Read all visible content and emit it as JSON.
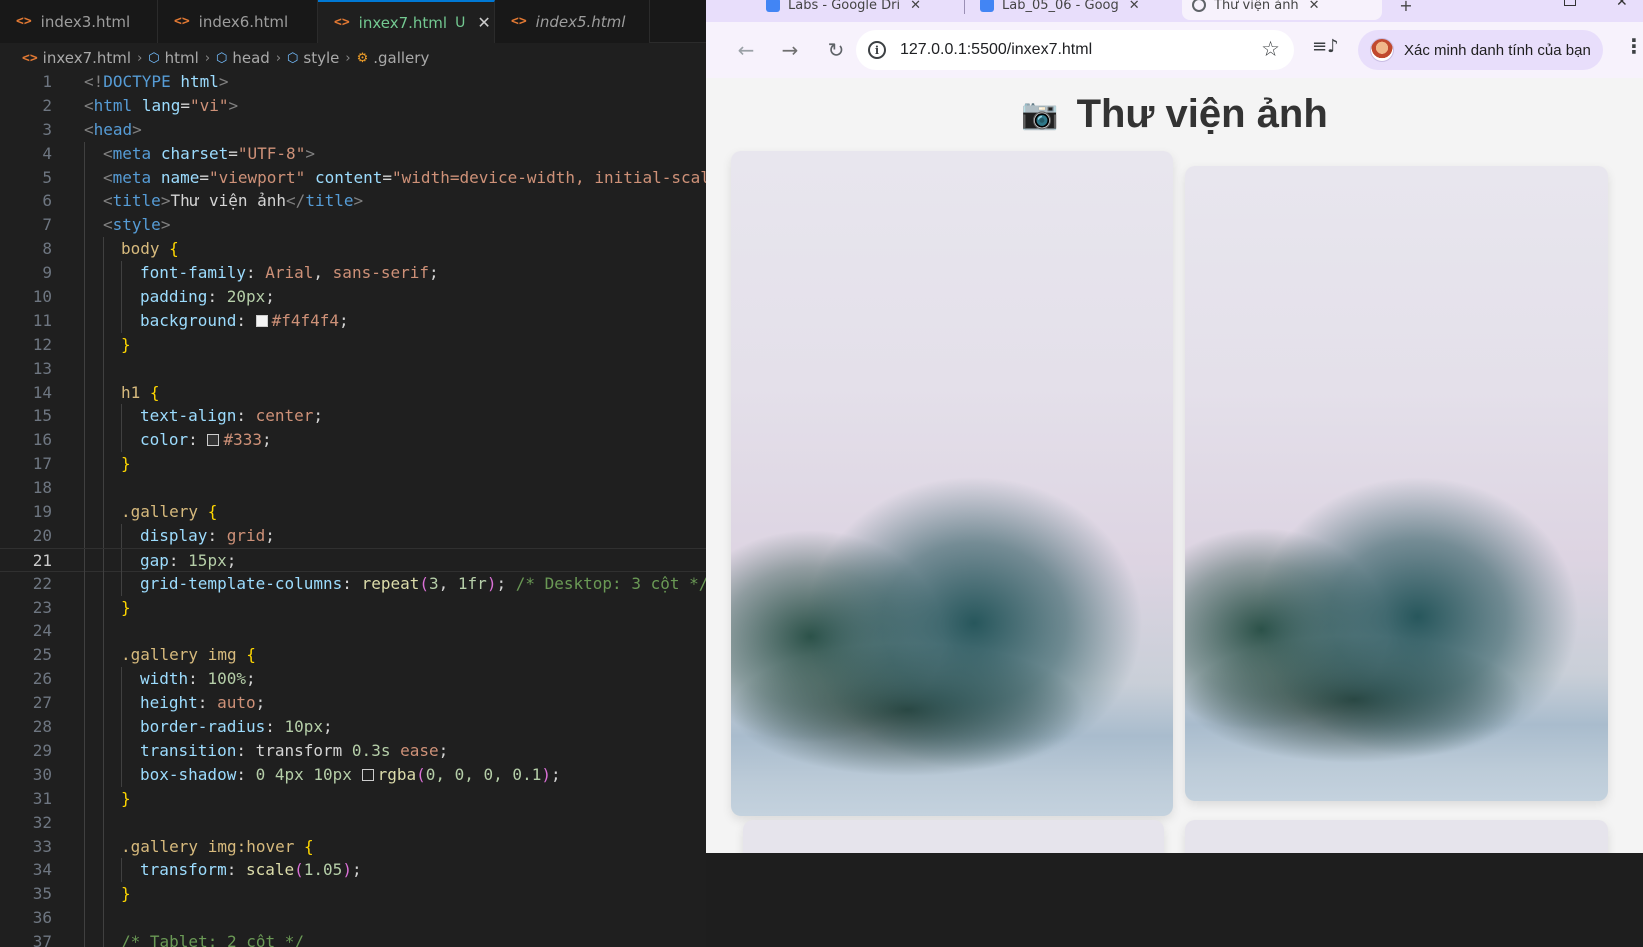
{
  "editor": {
    "tabs": [
      {
        "label": "index3.html",
        "active": false
      },
      {
        "label": "index6.html",
        "active": false
      },
      {
        "label": "inxex7.html",
        "active": true,
        "modified": "U"
      },
      {
        "label": "index5.html",
        "active": false
      }
    ],
    "breadcrumb": [
      "inxex7.html",
      "html",
      "head",
      "style",
      ".gallery"
    ],
    "current_line": 21,
    "line_numbers": [
      "1",
      "2",
      "3",
      "4",
      "5",
      "6",
      "7",
      "8",
      "9",
      "10",
      "11",
      "12",
      "13",
      "14",
      "15",
      "16",
      "17",
      "18",
      "19",
      "20",
      "21",
      "22",
      "23",
      "24",
      "25",
      "26",
      "27",
      "28",
      "29",
      "30",
      "31",
      "32",
      "33",
      "34",
      "35",
      "36",
      "37"
    ],
    "code": {
      "l1": {
        "a": "<!",
        "b": "DOCTYPE",
        "c": "html",
        "d": ">"
      },
      "l2": {
        "a": "<",
        "b": "html",
        "c": "lang",
        "d": "=",
        "e": "\"vi\"",
        "f": ">"
      },
      "l3": {
        "a": "<",
        "b": "head",
        "c": ">"
      },
      "l4": {
        "a": "<",
        "b": "meta",
        "c": "charset",
        "d": "=",
        "e": "\"UTF-8\"",
        "f": ">"
      },
      "l5": {
        "a": "<",
        "b": "meta",
        "c": "name",
        "d": "=",
        "e": "\"viewport\"",
        "f": "content",
        "g": "=",
        "h": "\"width=device-width, initial-scal"
      },
      "l6": {
        "a": "<",
        "b": "title",
        "c": ">",
        "d": "Thư viện ảnh",
        "e": "</",
        "f": "title",
        "g": ">"
      },
      "l7": {
        "a": "<",
        "b": "style",
        "c": ">"
      },
      "l8": {
        "a": "body",
        "b": "{"
      },
      "l9": {
        "a": "font-family",
        "b": ": ",
        "c": "Arial",
        "d": ", ",
        "e": "sans-serif",
        "f": ";"
      },
      "l10": {
        "a": "padding",
        "b": ": ",
        "c": "20px",
        "d": ";"
      },
      "l11": {
        "a": "background",
        "b": ": ",
        "c": "#f4f4f4",
        "d": ";"
      },
      "l12": {
        "a": "}"
      },
      "l14": {
        "a": "h1",
        "b": "{"
      },
      "l15": {
        "a": "text-align",
        "b": ": ",
        "c": "center",
        "d": ";"
      },
      "l16": {
        "a": "color",
        "b": ": ",
        "c": "#333",
        "d": ";"
      },
      "l17": {
        "a": "}"
      },
      "l19": {
        "a": ".gallery",
        "b": "{"
      },
      "l20": {
        "a": "display",
        "b": ": ",
        "c": "grid",
        "d": ";"
      },
      "l21": {
        "a": "gap",
        "b": ": ",
        "c": "15px",
        "d": ";"
      },
      "l22": {
        "a": "grid-template-columns",
        "b": ": ",
        "c": "repeat",
        "d": "(",
        "e": "3",
        "f": ", ",
        "g": "1fr",
        "h": ")",
        "i": "; ",
        "j": "/* Desktop: 3 cột */"
      },
      "l23": {
        "a": "}"
      },
      "l25": {
        "a": ".gallery img",
        "b": "{"
      },
      "l26": {
        "a": "width",
        "b": ": ",
        "c": "100%",
        "d": ";"
      },
      "l27": {
        "a": "height",
        "b": ": ",
        "c": "auto",
        "d": ";"
      },
      "l28": {
        "a": "border-radius",
        "b": ": ",
        "c": "10px",
        "d": ";"
      },
      "l29": {
        "a": "transition",
        "b": ": ",
        "c": "transform ",
        "d": "0.3s",
        "e": " ease",
        "f": ";"
      },
      "l30": {
        "a": "box-shadow",
        "b": ": ",
        "c": "0 4px 10px ",
        "d": "rgba",
        "e": "(",
        "f": "0, 0, 0, 0.1",
        "g": ")",
        "h": ";"
      },
      "l31": {
        "a": "}"
      },
      "l33": {
        "a": ".gallery img:hover",
        "b": "{"
      },
      "l34": {
        "a": "transform",
        "b": ": ",
        "c": "scale",
        "d": "(",
        "e": "1.05",
        "f": ")",
        "g": ";"
      },
      "l35": {
        "a": "}"
      },
      "l37": {
        "a": "/* Tablet: 2 cột */"
      }
    },
    "swatches": {
      "l11": "#f4f4f4",
      "l16": "#333333",
      "l30": "rgba(0,0,0,0.1)"
    }
  },
  "browser": {
    "tabs": [
      {
        "label": "Labs - Google Dri",
        "favicon_color": "#4285f4"
      },
      {
        "label": "Lab_05_06 - Goog",
        "favicon_color": "#4285f4"
      },
      {
        "label": "Thư viện ảnh",
        "favicon_color": "#5f6368",
        "active": true
      }
    ],
    "url": "127.0.0.1:5500/inxex7.html",
    "profile_label": "Xác minh danh tính của bạn",
    "icons": {
      "back": "arrow-left-icon",
      "forward": "arrow-right-icon",
      "reload": "reload-icon",
      "info": "info-icon",
      "star": "star-icon",
      "media": "media-controls-icon",
      "menu": "kebab-menu-icon"
    },
    "accent": "#e8defb"
  },
  "page": {
    "title_icon": "📷",
    "title": "Thư viện ảnh",
    "title_color": "#333333",
    "background": "#f4f4f4"
  }
}
